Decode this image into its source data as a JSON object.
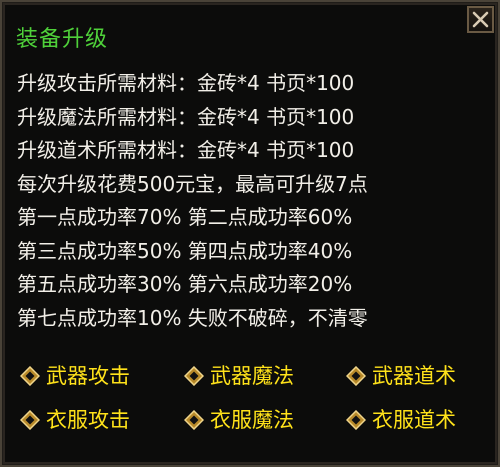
{
  "dialog": {
    "title": "装备升级",
    "close_icon": "close-icon"
  },
  "info_lines": [
    "升级攻击所需材料：金砖*4 书页*100",
    "升级魔法所需材料：金砖*4 书页*100",
    "升级道术所需材料：金砖*4 书页*100",
    "每次升级花费500元宝，最高可升级7点",
    "第一点成功率70% 第二点成功率60%",
    "第三点成功率50% 第四点成功率40%",
    "第五点成功率30% 第六点成功率20%",
    "第七点成功率10% 失败不破碎，不清零"
  ],
  "options": [
    {
      "label": "武器攻击",
      "icon": "diamond-bullet-icon"
    },
    {
      "label": "武器魔法",
      "icon": "diamond-bullet-icon"
    },
    {
      "label": "武器道术",
      "icon": "diamond-bullet-icon"
    },
    {
      "label": "衣服攻击",
      "icon": "diamond-bullet-icon"
    },
    {
      "label": "衣服魔法",
      "icon": "diamond-bullet-icon"
    },
    {
      "label": "衣服道术",
      "icon": "diamond-bullet-icon"
    }
  ],
  "colors": {
    "title": "#4fd13a",
    "text": "#f2efe8",
    "option_label": "#ffe21a",
    "background": "#0c0c0b",
    "border": "#4a4338"
  }
}
